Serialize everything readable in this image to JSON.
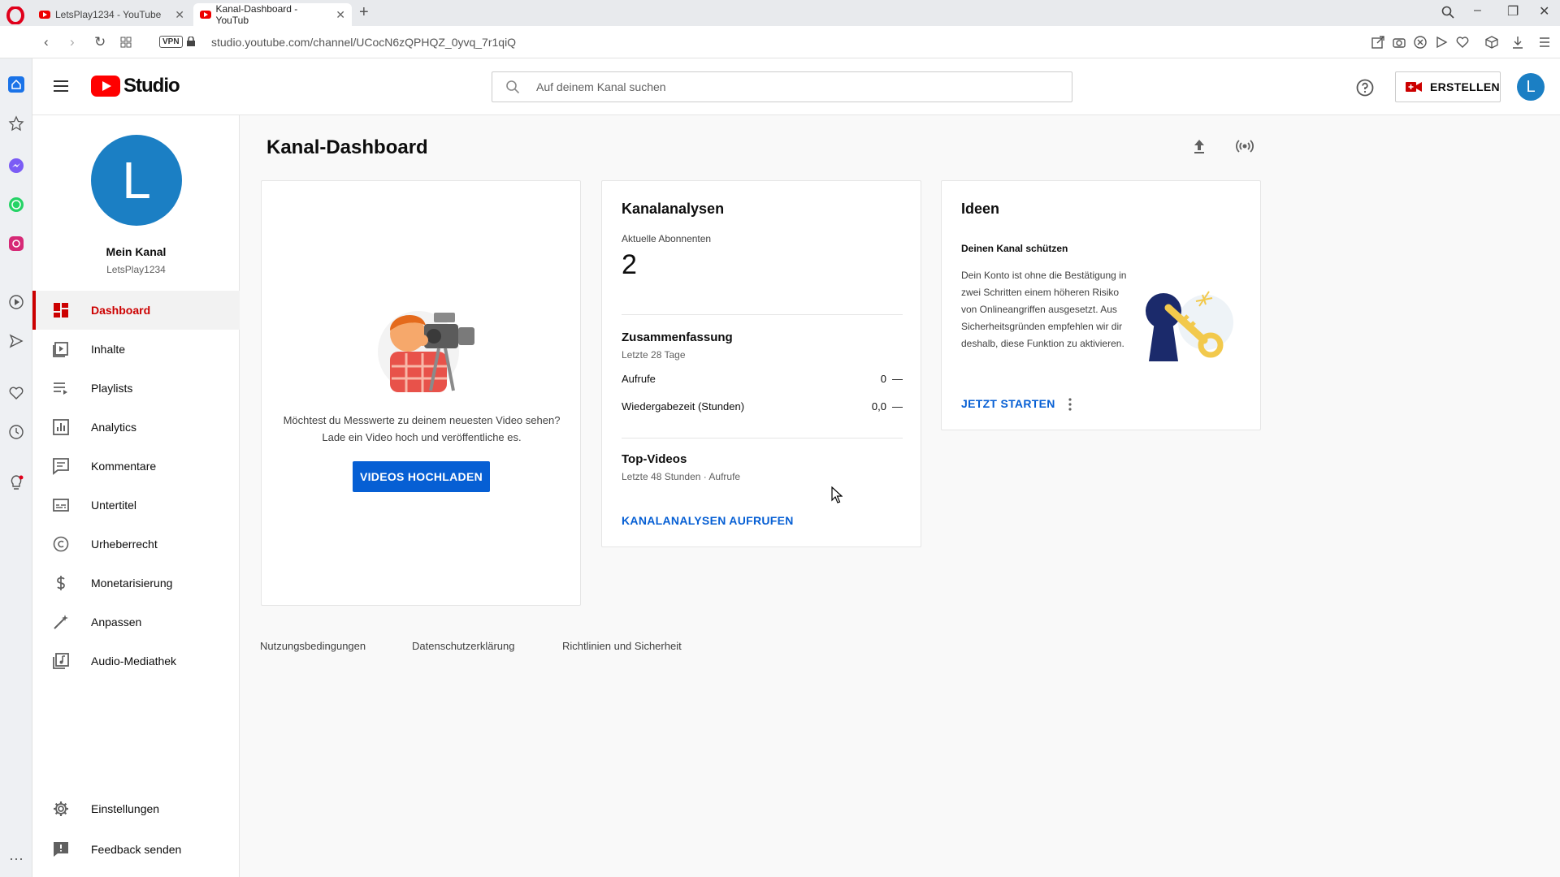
{
  "browser": {
    "tabs": [
      {
        "title": "LetsPlay1234 - YouTube",
        "active": false
      },
      {
        "title": "Kanal-Dashboard - YouTub",
        "active": true
      }
    ],
    "vpn_label": "VPN",
    "url": "studio.youtube.com/channel/UCocN6zQPHQZ_0yvq_7r1qiQ"
  },
  "header": {
    "logo_text": "Studio",
    "search_placeholder": "Auf deinem Kanal suchen",
    "create_label": "ERSTELLEN",
    "avatar_letter": "L"
  },
  "channel": {
    "avatar_letter": "L",
    "name": "Mein Kanal",
    "handle": "LetsPlay1234"
  },
  "nav": {
    "items": [
      {
        "label": "Dashboard",
        "icon": "dashboard-icon",
        "active": true
      },
      {
        "label": "Inhalte",
        "icon": "content-icon"
      },
      {
        "label": "Playlists",
        "icon": "playlists-icon"
      },
      {
        "label": "Analytics",
        "icon": "analytics-icon"
      },
      {
        "label": "Kommentare",
        "icon": "comments-icon"
      },
      {
        "label": "Untertitel",
        "icon": "subtitles-icon"
      },
      {
        "label": "Urheberrecht",
        "icon": "copyright-icon"
      },
      {
        "label": "Monetarisierung",
        "icon": "dollar-icon"
      },
      {
        "label": "Anpassen",
        "icon": "customize-icon"
      },
      {
        "label": "Audio-Mediathek",
        "icon": "audio-library-icon"
      }
    ],
    "bottom": [
      {
        "label": "Einstellungen",
        "icon": "gear-icon"
      },
      {
        "label": "Feedback senden",
        "icon": "feedback-icon"
      }
    ]
  },
  "main": {
    "title": "Kanal-Dashboard",
    "upload_card": {
      "text_line1": "Möchtest du Messwerte zu deinem neuesten Video sehen?",
      "text_line2": "Lade ein Video hoch und veröffentliche es.",
      "button": "VIDEOS HOCHLADEN"
    },
    "analytics_card": {
      "title": "Kanalanalysen",
      "subs_label": "Aktuelle Abonnenten",
      "subs_value": "2",
      "summary_title": "Zusammenfassung",
      "summary_sub": "Letzte 28 Tage",
      "rows": [
        {
          "label": "Aufrufe",
          "value": "0",
          "trend": "—"
        },
        {
          "label": "Wiedergabezeit (Stunden)",
          "value": "0,0",
          "trend": "—"
        }
      ],
      "top_title": "Top-Videos",
      "top_sub": "Letzte 48 Stunden · Aufrufe",
      "link": "KANALANALYSEN AUFRUFEN"
    },
    "ideas_card": {
      "title": "Ideen",
      "heading": "Deinen Kanal schützen",
      "body": "Dein Konto ist ohne die Bestätigung in zwei Schritten einem höheren Risiko von Onlineangriffen ausgesetzt. Aus Sicherheitsgründen empfehlen wir dir deshalb, diese Funktion zu aktivieren.",
      "link": "JETZT STARTEN"
    },
    "footer": {
      "terms": "Nutzungsbedingungen",
      "privacy": "Datenschutzerklärung",
      "policy": "Richtlinien und Sicherheit"
    }
  },
  "colors": {
    "brand_red": "#ff0000",
    "active_red": "#cc0000",
    "link_blue": "#065fd4",
    "avatar_blue": "#1b7fc4"
  }
}
